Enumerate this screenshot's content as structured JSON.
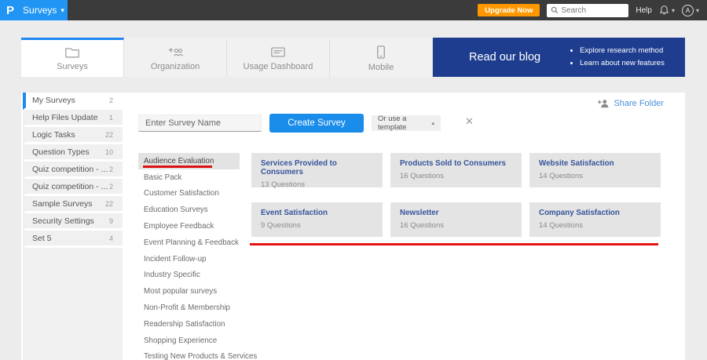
{
  "topbar": {
    "logo": "P",
    "app_menu": "Surveys",
    "upgrade_label": "Upgrade Now",
    "search_placeholder": "Search",
    "help_label": "Help",
    "avatar_initial": "A"
  },
  "icons": {
    "caret_down": "▾",
    "caret_up": "▴",
    "close": "✕"
  },
  "tabs": [
    {
      "label": "Surveys",
      "active": true
    },
    {
      "label": "Organization",
      "active": false
    },
    {
      "label": "Usage Dashboard",
      "active": false
    },
    {
      "label": "Mobile",
      "active": false
    }
  ],
  "blog_banner": {
    "title": "Read our blog",
    "bullets": [
      "Explore research method",
      "Learn about new features"
    ]
  },
  "sidebar": {
    "items": [
      {
        "label": "My Surveys",
        "count": "2",
        "active": true
      },
      {
        "label": "Help Files Update",
        "count": "1",
        "active": false
      },
      {
        "label": "Logic Tasks",
        "count": "22",
        "active": false
      },
      {
        "label": "Question Types",
        "count": "10",
        "active": false
      },
      {
        "label": "Quiz competition - ...",
        "count": "2",
        "active": false
      },
      {
        "label": "Quiz competition - ...",
        "count": "2",
        "active": false
      },
      {
        "label": "Sample Surveys",
        "count": "22",
        "active": false
      },
      {
        "label": "Security Settings",
        "count": "9",
        "active": false
      },
      {
        "label": "Set 5",
        "count": "4",
        "active": false
      }
    ]
  },
  "toolbar": {
    "survey_name_placeholder": "Enter Survey Name",
    "create_button": "Create Survey",
    "template_dropdown": "Or use a template",
    "share_folder": "Share Folder"
  },
  "template_categories": {
    "selected": "Audience Evaluation",
    "items": [
      {
        "label": "Audience Evaluation",
        "active": true
      },
      {
        "label": "Basic Pack",
        "active": false
      },
      {
        "label": "Customer Satisfaction",
        "active": false
      },
      {
        "label": "Education Surveys",
        "active": false
      },
      {
        "label": "Employee Feedback",
        "active": false
      },
      {
        "label": "Event Planning & Feedback",
        "active": false
      },
      {
        "label": "Incident Follow-up",
        "active": false
      },
      {
        "label": "Industry Specific",
        "active": false
      },
      {
        "label": "Most popular surveys",
        "active": false
      },
      {
        "label": "Non-Profit & Membership",
        "active": false
      },
      {
        "label": "Readership Satisfaction",
        "active": false
      },
      {
        "label": "Shopping Experience",
        "active": false
      },
      {
        "label": "Testing New Products & Services",
        "active": false
      }
    ]
  },
  "templates": [
    {
      "title": "Services Provided to Consumers",
      "questions": "13 Questions"
    },
    {
      "title": "Products Sold to Consumers",
      "questions": "16 Questions"
    },
    {
      "title": "Website Satisfaction",
      "questions": "14 Questions"
    },
    {
      "title": "Event Satisfaction",
      "questions": "9 Questions"
    },
    {
      "title": "Newsletter",
      "questions": "16 Questions"
    },
    {
      "title": "Company Satisfaction",
      "questions": "14 Questions"
    }
  ],
  "colors": {
    "brand_blue": "#2095f3",
    "topbar_dark": "#3b3b3b",
    "upgrade_orange": "#ff9800",
    "create_blue": "#1a8cea",
    "banner_navy": "#1e3d8f",
    "card_title_blue": "#35549a",
    "annotation_red": "#e21414"
  }
}
